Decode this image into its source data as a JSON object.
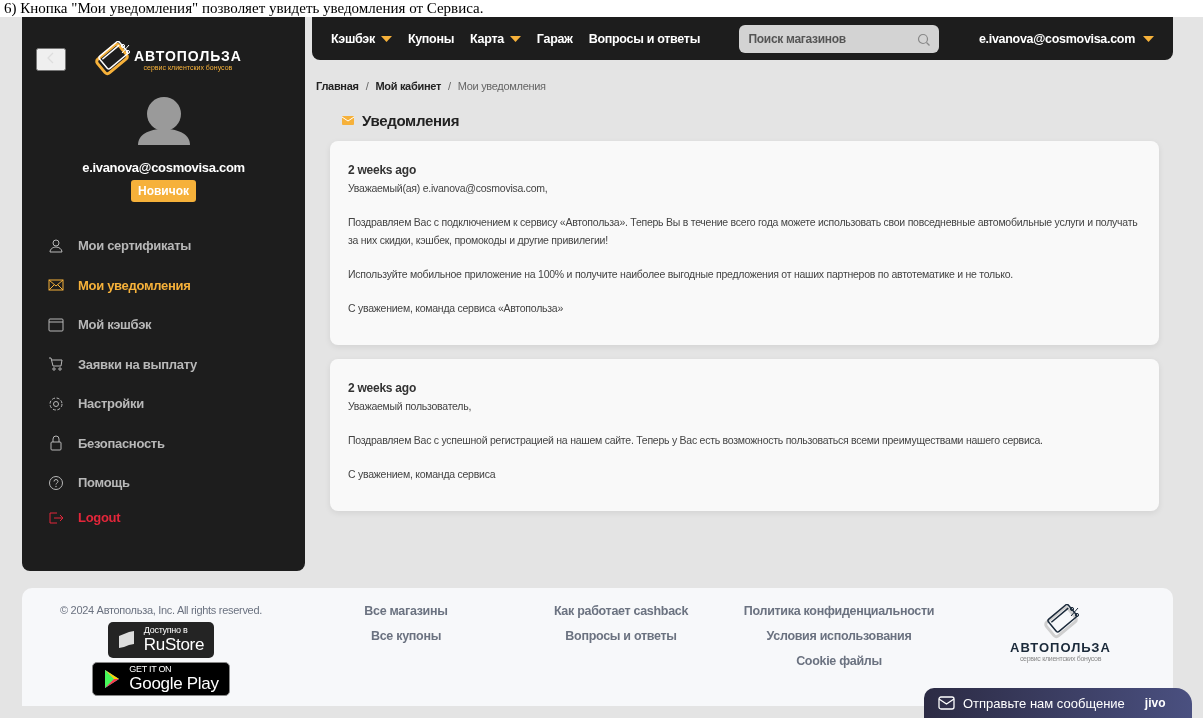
{
  "caption": "6) Кнопка \"Мои уведомления\" позволяет увидеть уведомления от Сервиса.",
  "sidebar": {
    "logo": {
      "name": "АВТОПОЛЬЗА",
      "tagline": "сервис клиентских бонусов"
    },
    "user": {
      "email": "e.ivanova@cosmovisa.com",
      "badge": "Новичок"
    },
    "items": [
      {
        "kind": "person",
        "label": "Мои сертификаты",
        "selected": false
      },
      {
        "kind": "mail",
        "label": "Мои уведомления",
        "selected": true
      },
      {
        "kind": "wallet",
        "label": "Мой кэшбэк",
        "selected": false
      },
      {
        "kind": "cart",
        "label": "Заявки на выплату",
        "selected": false
      },
      {
        "kind": "gear",
        "label": "Настройки",
        "selected": false
      },
      {
        "kind": "lock",
        "label": "Безопасность",
        "selected": false
      },
      {
        "kind": "help",
        "label": "Помощь",
        "selected": false
      },
      {
        "kind": "logout",
        "label": "Logout",
        "selected": false
      }
    ]
  },
  "topbar": {
    "items": [
      {
        "label": "Кэшбэк",
        "dropdown": true
      },
      {
        "label": "Купоны",
        "dropdown": false
      },
      {
        "label": "Карта",
        "dropdown": true
      },
      {
        "label": "Гараж",
        "dropdown": false
      },
      {
        "label": "Вопросы и ответы",
        "dropdown": false
      }
    ],
    "search": {
      "placeholder": "Поиск магазинов"
    },
    "account": {
      "email": "e.ivanova@cosmovisa.com",
      "dropdown": true
    }
  },
  "breadcrumb": [
    {
      "kind": "link",
      "label": "Главная",
      "current": false
    },
    {
      "kind": "separator",
      "label": "/"
    },
    {
      "kind": "link",
      "label": "Мой кабинет",
      "current": false
    },
    {
      "kind": "separator",
      "label": "/"
    },
    {
      "kind": "link",
      "label": "Мои уведомления",
      "current": true
    }
  ],
  "section_title": "Уведомления",
  "notifications": [
    {
      "time": "2 weeks ago",
      "paragraphs": [
        "Уважаемый(ая) e.ivanova@cosmovisa.com,",
        "Поздравляем Вас с подключением к сервису «Автопольза». Теперь Вы в течение всего года можете использовать свои повседневные автомобильные услуги и получать за них скидки, кэшбек, промокоды и другие привилегии!",
        "Используйте мобильное приложение на 100% и получите наиболее выгодные предложения от наших партнеров по автотематике и не только.",
        "С уважением, команда сервиса «Автопольза»"
      ]
    },
    {
      "time": "2 weeks ago",
      "paragraphs": [
        "Уважаемый пользователь,",
        "Поздравляем Вас с успешной регистрацией на нашем сайте. Теперь у Вас есть возможность пользоваться всеми преимуществами нашего сервиса.",
        "С уважением, команда сервиса"
      ]
    }
  ],
  "footer": {
    "copyright": "© 2024 Автопольза, Inc. All rights reserved.",
    "badges": [
      {
        "kind": "rustore",
        "small": "Доступно в",
        "big": "RuStore"
      },
      {
        "kind": "googleplay",
        "small": "GET IT ON",
        "big": "Google Play"
      }
    ],
    "link_columns": [
      [
        "Все магазины",
        "Все купоны"
      ],
      [
        "Как работает cashback",
        "Вопросы и ответы"
      ],
      [
        "Политика конфиденциальности",
        "Условия использования",
        "Cookie файлы"
      ]
    ],
    "logo": {
      "name": "АВТОПОЛЬЗА",
      "tagline": "сервис клиентских бонусов"
    }
  },
  "chat": {
    "label": "Отправьте нам сообщение",
    "brand": "jivo"
  }
}
